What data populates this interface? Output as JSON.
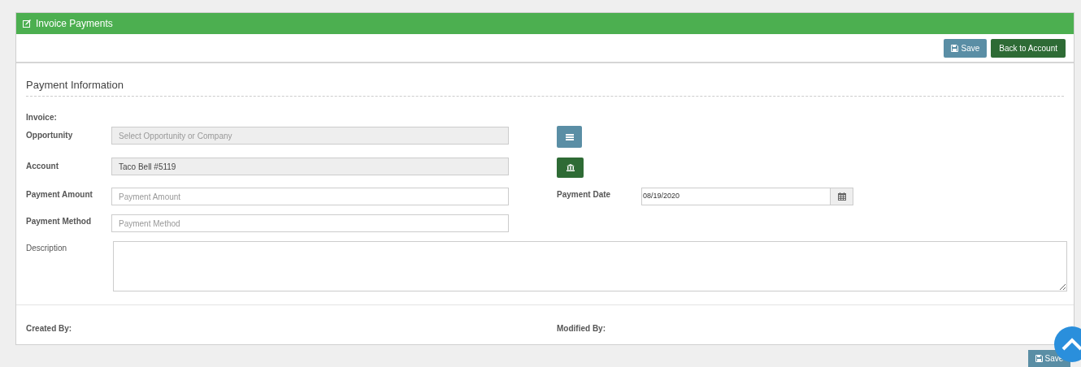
{
  "panel": {
    "title": "Invoice Payments"
  },
  "toolbar": {
    "buttons": [
      {
        "label": "Save",
        "kind": "save"
      },
      {
        "label": "Back to Account",
        "kind": "back"
      }
    ]
  },
  "section": {
    "title": "Payment Information"
  },
  "invoice": {
    "label": "Invoice:"
  },
  "opportunity": {
    "label": "Opportunity",
    "placeholder": "Select Opportunity or Company",
    "disabled": true
  },
  "account": {
    "label": "Account",
    "value": "Taco Bell #5119",
    "disabled": true
  },
  "payment_amount": {
    "label": "Payment Amount",
    "placeholder": "Payment Amount"
  },
  "payment_date": {
    "label": "Payment Date",
    "value": "08/19/2020"
  },
  "payment_method": {
    "label": "Payment Method",
    "placeholder": "Payment Method"
  },
  "description": {
    "label": "Description"
  },
  "footer": {
    "created_by": "Created By:",
    "modified_by": "Modified By:"
  },
  "bottom_button": {
    "label": "Save"
  }
}
